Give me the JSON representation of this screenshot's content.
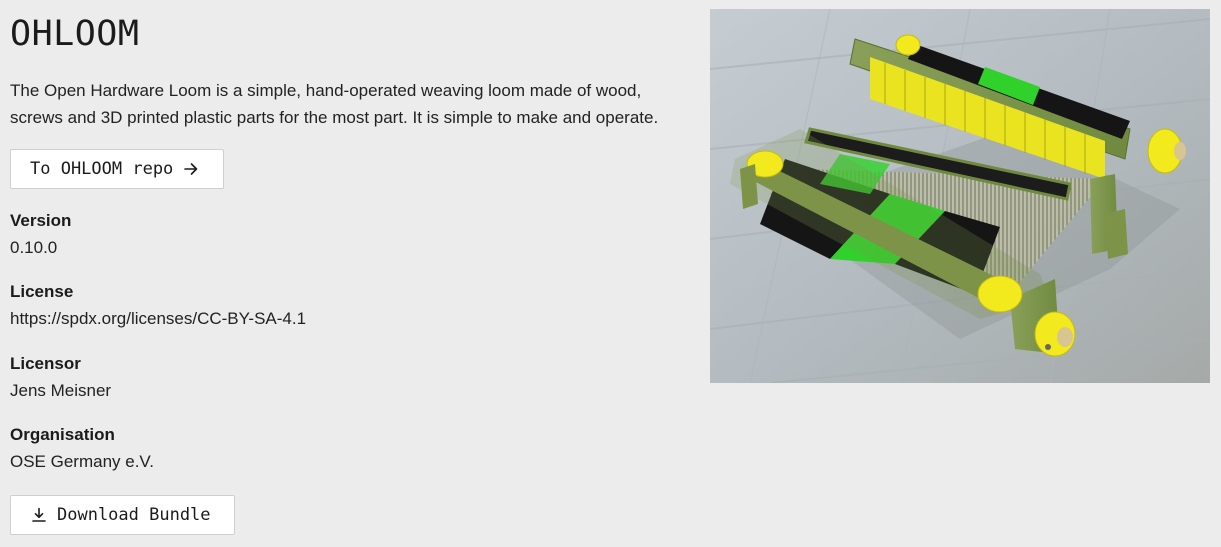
{
  "project": {
    "title": "OHLOOM",
    "description": "The Open Hardware Loom is a simple, hand-operated weaving loom made of wood, screws and 3D printed plastic parts for the most part. It is simple to make and operate.",
    "repo_button_label": "To OHLOOM repo",
    "download_button_label": "Download Bundle"
  },
  "metadata": [
    {
      "label": "Version",
      "value": "0.10.0"
    },
    {
      "label": "License",
      "value": "https://spdx.org/licenses/CC-BY-SA-4.1"
    },
    {
      "label": "Licensor",
      "value": "Jens Meisner"
    },
    {
      "label": "Organisation",
      "value": "OSE Germany e.V."
    }
  ],
  "icons": {
    "repo_button": "arrow-right-icon",
    "download_button": "download-icon"
  },
  "image": {
    "subject": "photo of a wooden weaving loom with yellow 3D printed parts and green/black yarn"
  },
  "colors": {
    "background": "#ececec",
    "button_background": "#ffffff",
    "button_border": "#cfcfcf",
    "text": "#1b1b1b",
    "loom_yellow": "#f2ea1c",
    "yarn_green": "#2fd12a",
    "yarn_black": "#151515"
  }
}
